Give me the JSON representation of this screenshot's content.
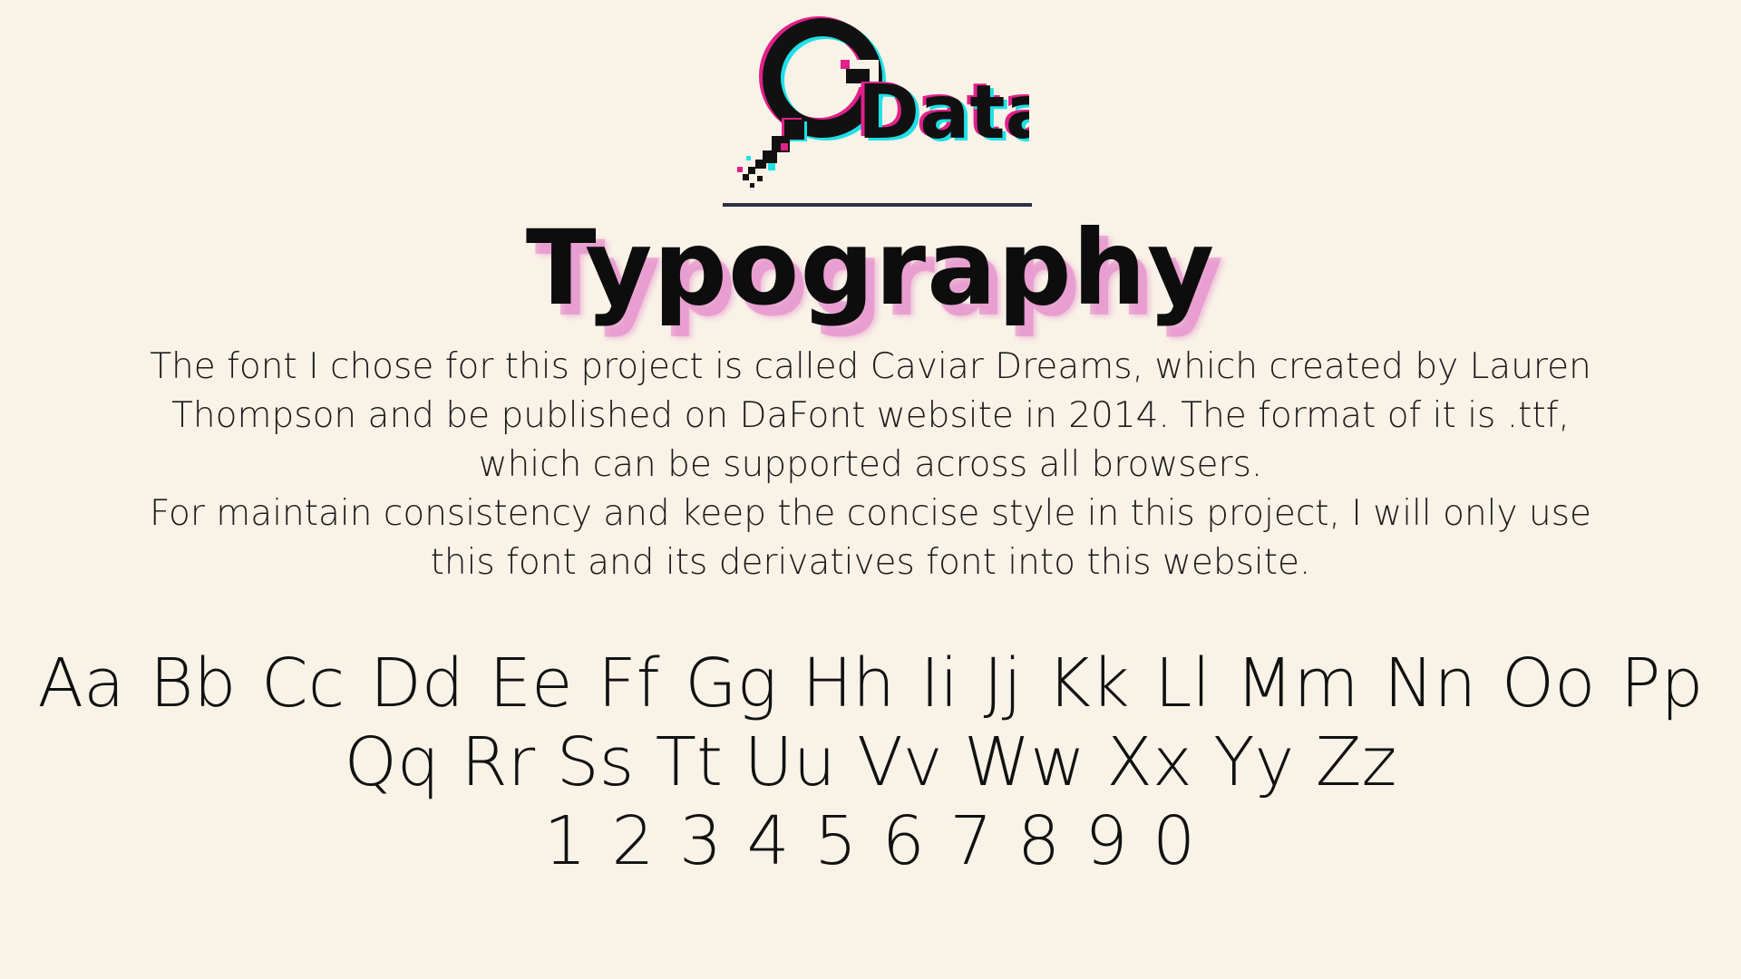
{
  "logo": {
    "text": "Data",
    "colors": {
      "ink": "#111111",
      "cyan": "#1fe0e6",
      "magenta": "#e0218a"
    }
  },
  "heading": "Typography",
  "body": {
    "paragraph1": "The font I chose for this project is called Caviar Dreams, which created by Lauren Thompson and be published on DaFont website in 2014. The format of it is .ttf, which can be supported across all browsers.",
    "paragraph2": "For maintain consistency and keep the concise style in this project, I will only use this font and its derivatives font into this website."
  },
  "specimen": {
    "row1": "Aa Bb Cc Dd Ee Ff Gg Hh Ii Jj Kk Ll Mm Nn Oo Pp",
    "row2": "Qq Rr Ss Tt Uu Vv Ww Xx Yy Zz",
    "row3": "1 2 3 4 5 6 7 8 9 0"
  },
  "colors": {
    "background": "#f9f2e7",
    "divider": "#2e3045",
    "heading_shadow": "#e282c8"
  }
}
